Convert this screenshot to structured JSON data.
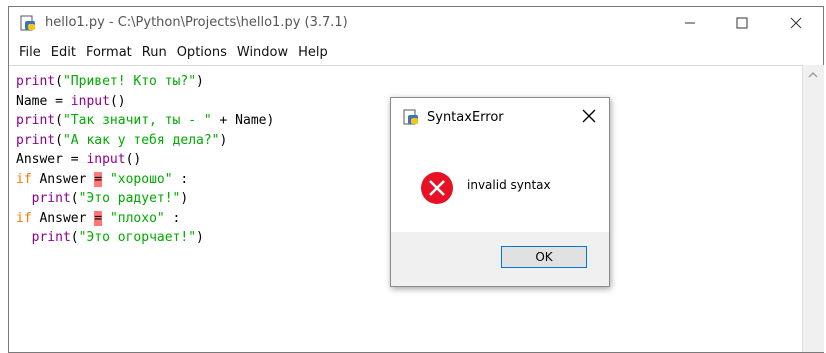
{
  "window": {
    "title": "hello1.py - C:\\Python\\Projects\\hello1.py (3.7.1)",
    "controls": {
      "minimize": "minimize-icon",
      "maximize": "maximize-icon",
      "close": "close-icon"
    }
  },
  "menu": [
    "File",
    "Edit",
    "Format",
    "Run",
    "Options",
    "Window",
    "Help"
  ],
  "code": {
    "lines": [
      [
        [
          "b",
          "print"
        ],
        [
          "p",
          "("
        ],
        [
          "s",
          "\"Привет! Кто ты?\""
        ],
        [
          "p",
          ")"
        ]
      ],
      [
        [
          "p",
          "Name = "
        ],
        [
          "b",
          "input"
        ],
        [
          "p",
          "()"
        ]
      ],
      [
        [
          "b",
          "print"
        ],
        [
          "p",
          "("
        ],
        [
          "s",
          "\"Так значит, ты - \""
        ],
        [
          "p",
          " + Name)"
        ]
      ],
      [
        [
          "b",
          "print"
        ],
        [
          "p",
          "("
        ],
        [
          "s",
          "\"А как у тебя дела?\""
        ],
        [
          "p",
          ")"
        ]
      ],
      [
        [
          "p",
          "Answer = "
        ],
        [
          "b",
          "input"
        ],
        [
          "p",
          "()"
        ]
      ],
      [
        [
          "k",
          "if"
        ],
        [
          "p",
          " Answer "
        ],
        [
          "e",
          "="
        ],
        [
          "p",
          " "
        ],
        [
          "s",
          "\"хорошо\""
        ],
        [
          "p",
          " :"
        ]
      ],
      [
        [
          "p",
          "  "
        ],
        [
          "b",
          "print"
        ],
        [
          "p",
          "("
        ],
        [
          "s",
          "\"Это радует!\""
        ],
        [
          "p",
          ")"
        ]
      ],
      [
        [
          "k",
          "if"
        ],
        [
          "p",
          " Answer "
        ],
        [
          "e",
          "="
        ],
        [
          "p",
          " "
        ],
        [
          "s",
          "\"плохо\""
        ],
        [
          "p",
          " :"
        ]
      ],
      [
        [
          "p",
          "  "
        ],
        [
          "b",
          "print"
        ],
        [
          "p",
          "("
        ],
        [
          "s",
          "\"Это огорчает!\""
        ],
        [
          "p",
          ")"
        ]
      ]
    ]
  },
  "dialog": {
    "title": "SyntaxError",
    "message": "invalid syntax",
    "ok_label": "OK",
    "icon": "error-icon"
  },
  "colors": {
    "builtin": "#900090",
    "keyword": "#ff7700",
    "string": "#00aa00",
    "error_highlight": "#ff7777",
    "error_icon": "#e81123"
  }
}
